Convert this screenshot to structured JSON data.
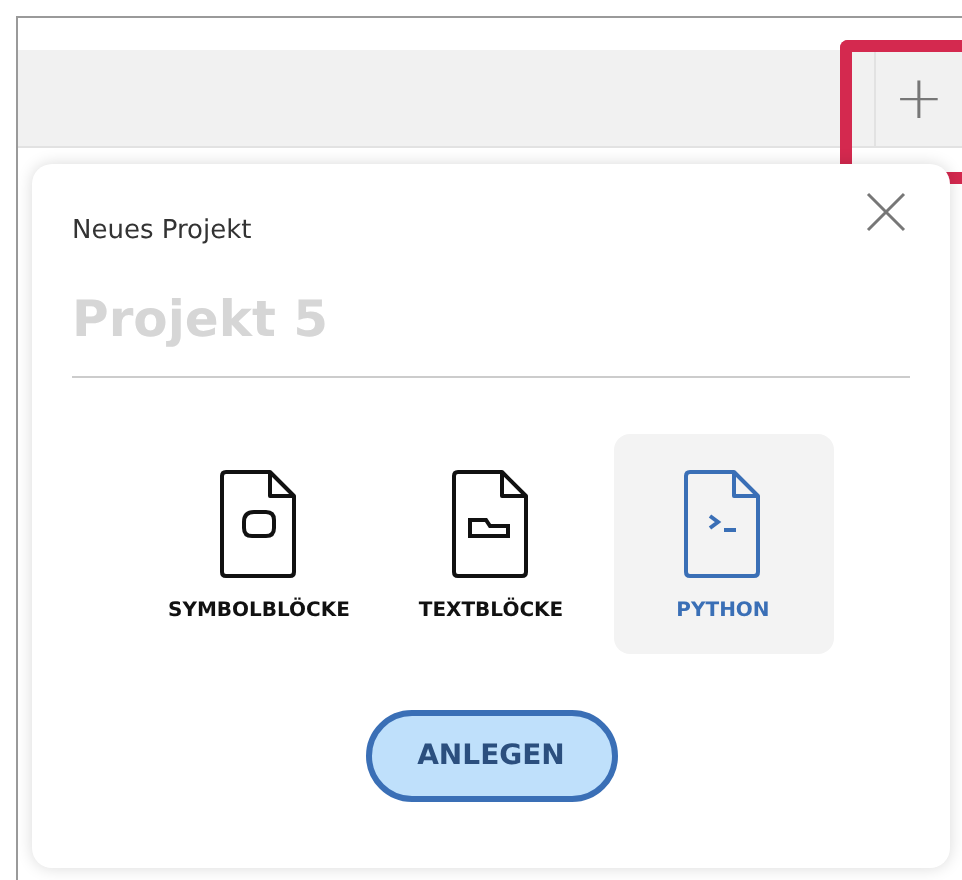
{
  "toolbar": {
    "add_button": "+",
    "highlighted": true
  },
  "dialog": {
    "title": "Neues Projekt",
    "name_field": {
      "placeholder": "Projekt 5"
    },
    "types": [
      {
        "kind": "symbol",
        "label": "SYMBOLBLÖCKE",
        "selected": false
      },
      {
        "kind": "text",
        "label": "TEXTBLÖCKE",
        "selected": false
      },
      {
        "kind": "python",
        "label": "PYTHON",
        "selected": true
      }
    ],
    "create_button": "ANLEGEN"
  }
}
